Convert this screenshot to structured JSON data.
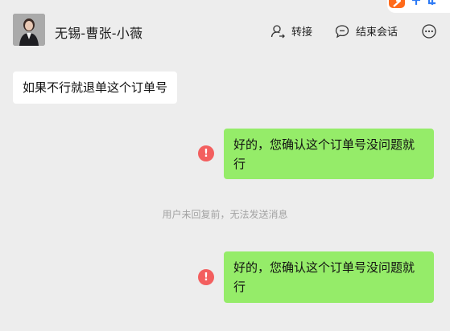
{
  "header": {
    "contact_name": "无锡-曹张-小薇",
    "avatar_icon": "person-avatar",
    "transfer_label": "转接",
    "transfer_icon": "user-transfer-icon",
    "end_session_label": "结束会话",
    "end_session_icon": "chat-bubble-icon",
    "more_icon": "more-dots-icon"
  },
  "messages": [
    {
      "direction": "incoming",
      "text": "如果不行就退单这个订单号"
    },
    {
      "direction": "outgoing",
      "text": "好的，您确认这个订单号没问题就行",
      "status_icon": "send-failed-icon",
      "status_glyph": "!"
    },
    {
      "direction": "outgoing",
      "text": "好的，您确认这个订单号没问题就行",
      "status_icon": "send-failed-icon",
      "status_glyph": "!"
    }
  ],
  "system_note": "用户未回复前，无法发送消息",
  "colors": {
    "background": "#ededed",
    "incoming_bubble": "#ffffff",
    "outgoing_bubble": "#95ec69",
    "error": "#f35f5f",
    "system_text": "#a3a3a3"
  }
}
